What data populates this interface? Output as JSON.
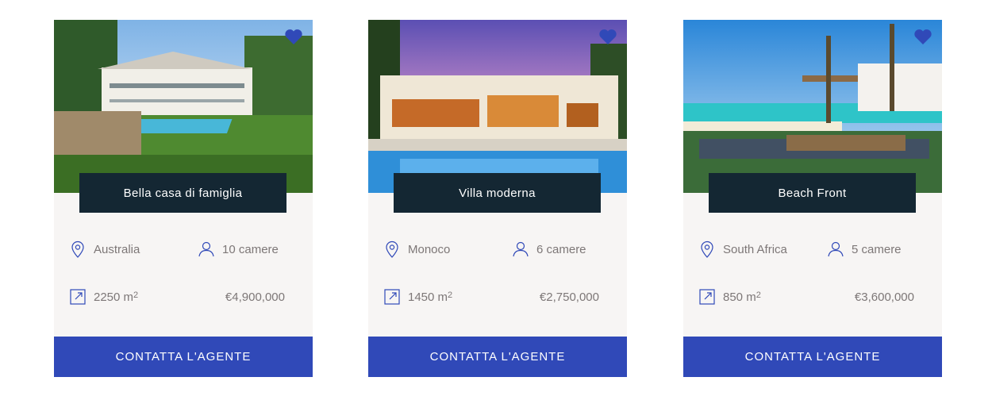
{
  "colors": {
    "accent": "#3049b8",
    "title_bg": "#142733",
    "card_bg": "#f7f5f4",
    "text": "#7d7777"
  },
  "icons": {
    "favorite": "heart-icon",
    "location": "map-pin-icon",
    "rooms": "user-icon",
    "area": "area-icon"
  },
  "listings": [
    {
      "title": "Bella casa di famiglia",
      "location": "Australia",
      "rooms": "10 camere",
      "area": "2250 m",
      "area_unit_sup": "2",
      "price": "€4,900,000",
      "cta": "CONTATTA L'AGENTE"
    },
    {
      "title": "Villa moderna",
      "location": "Monoco",
      "rooms": "6 camere",
      "area": "1450 m",
      "area_unit_sup": "2",
      "price": "€2,750,000",
      "cta": "CONTATTA L'AGENTE"
    },
    {
      "title": "Beach Front",
      "location": "South Africa",
      "rooms": "5 camere",
      "area": "850 m",
      "area_unit_sup": "2",
      "price": "€3,600,000",
      "cta": "CONTATTA L'AGENTE"
    }
  ]
}
